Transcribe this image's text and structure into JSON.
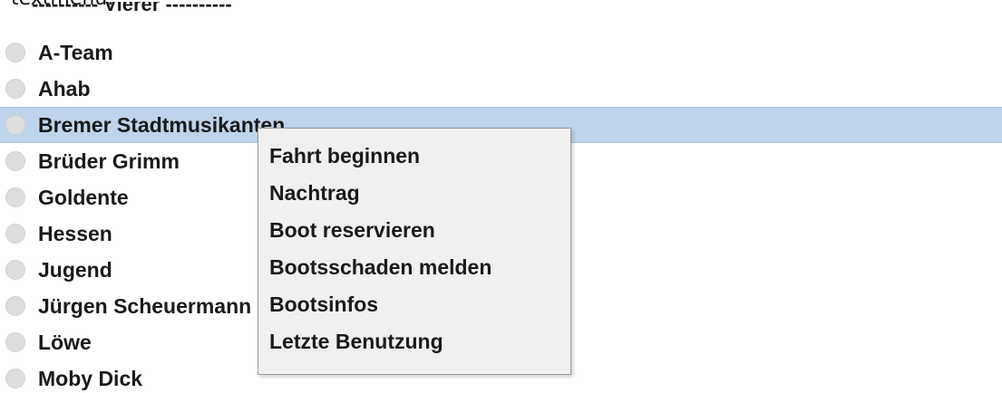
{
  "top_fragment": "textmenü.",
  "group_header": "---------- Vierer ----------",
  "boats": [
    {
      "name": "A-Team",
      "selected": false
    },
    {
      "name": "Ahab",
      "selected": false
    },
    {
      "name": "Bremer Stadtmusikanten",
      "selected": true
    },
    {
      "name": "Brüder Grimm",
      "selected": false
    },
    {
      "name": "Goldente",
      "selected": false
    },
    {
      "name": "Hessen",
      "selected": false
    },
    {
      "name": "Jugend",
      "selected": false
    },
    {
      "name": "Jürgen Scheuermann",
      "selected": false
    },
    {
      "name": "Löwe",
      "selected": false
    },
    {
      "name": "Moby Dick",
      "selected": false
    }
  ],
  "context_menu": {
    "items": [
      "Fahrt beginnen",
      "Nachtrag",
      "Boot reservieren",
      "Bootsschaden melden",
      "Bootsinfos",
      "Letzte Benutzung"
    ]
  },
  "colors": {
    "selection_bg": "#bfd4ea",
    "menu_bg": "#f0f0f0",
    "radio": "#dedede"
  }
}
